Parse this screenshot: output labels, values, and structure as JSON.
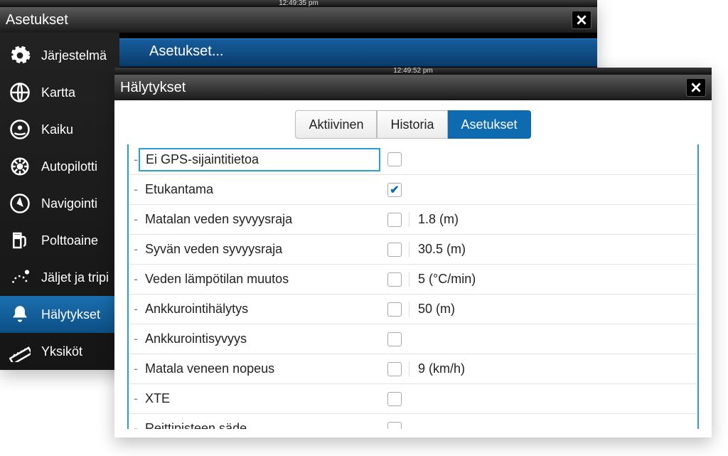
{
  "back_window": {
    "top_time": "12:49:35 pm",
    "title": "Asetukset",
    "banner": "Asetukset...",
    "sidebar": [
      {
        "icon": "gear",
        "label": "Järjestelmä",
        "active": false
      },
      {
        "icon": "globe",
        "label": "Kartta",
        "active": false
      },
      {
        "icon": "sonar",
        "label": "Kaiku",
        "active": false
      },
      {
        "icon": "wheel",
        "label": "Autopilotti",
        "active": false
      },
      {
        "icon": "compass",
        "label": "Navigointi",
        "active": false
      },
      {
        "icon": "fuel",
        "label": "Polttoaine",
        "active": false
      },
      {
        "icon": "trail",
        "label": "Jäljet ja tripi",
        "active": false
      },
      {
        "icon": "bell",
        "label": "Hälytykset",
        "active": true
      },
      {
        "icon": "ruler",
        "label": "Yksiköt",
        "active": false
      }
    ]
  },
  "front_window": {
    "top_time": "12:49:52 pm",
    "title": "Hälytykset",
    "tabs": [
      {
        "label": "Aktiivinen",
        "active": false
      },
      {
        "label": "Historia",
        "active": false
      },
      {
        "label": "Asetukset",
        "active": true
      }
    ],
    "rows": [
      {
        "label": "Ei GPS-sijaintitietoa",
        "checked": false,
        "value": "",
        "selected": true
      },
      {
        "label": "Etukantama",
        "checked": true,
        "value": ""
      },
      {
        "label": "Matalan veden syvyysraja",
        "checked": false,
        "value": "1.8 (m)"
      },
      {
        "label": "Syvän veden syvyysraja",
        "checked": false,
        "value": "30.5 (m)"
      },
      {
        "label": "Veden lämpötilan muutos",
        "checked": false,
        "value": "5 (°C/min)"
      },
      {
        "label": "Ankkurointihälytys",
        "checked": false,
        "value": "50 (m)"
      },
      {
        "label": "Ankkurointisyvyys",
        "checked": false,
        "value": ""
      },
      {
        "label": "Matala veneen nopeus",
        "checked": false,
        "value": "9 (km/h)"
      },
      {
        "label": "XTE",
        "checked": false,
        "value": ""
      },
      {
        "label": "Reittipisteen säde",
        "checked": false,
        "value": ""
      }
    ]
  }
}
